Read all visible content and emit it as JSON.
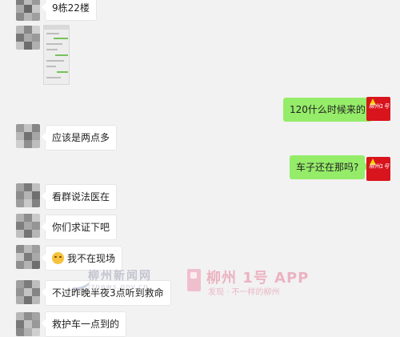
{
  "messages": [
    {
      "side": "left",
      "text": "9栋22楼"
    },
    {
      "side": "left",
      "type": "image"
    },
    {
      "side": "right",
      "text": "120什么时候来的"
    },
    {
      "side": "left",
      "text": "应该是两点多"
    },
    {
      "side": "right",
      "text": "车子还在那吗?"
    },
    {
      "side": "left",
      "text": "看群说法医在"
    },
    {
      "side": "left",
      "text": "你们求证下吧"
    },
    {
      "side": "left",
      "text": "我不在现场",
      "emoji": "sad-emoji"
    },
    {
      "side": "left",
      "text": "不过昨晚半夜3点听到救命"
    },
    {
      "side": "left",
      "text": "救护车一点到的"
    }
  ],
  "watermark": {
    "site_name": "柳州新闻网",
    "site_url": "lznews.gov.cn",
    "app_name": "柳州 1号 APP",
    "app_slogan": "发现 · 不一样的柳州"
  },
  "logo_text": "柳州1号",
  "colors": {
    "background": "#f2f2f2",
    "bubble_self": "#95ec69",
    "bubble_other": "#ffffff",
    "logo": "#d8141c"
  }
}
